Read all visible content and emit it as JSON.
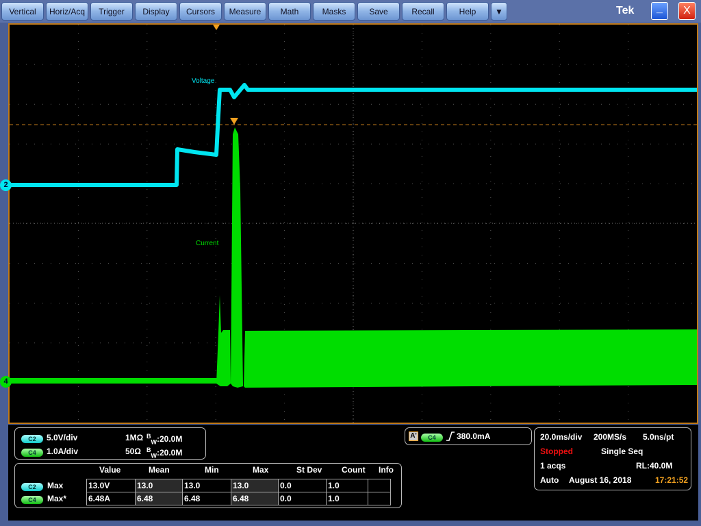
{
  "menu": {
    "items": [
      "Vertical",
      "Horiz/Acq",
      "Trigger",
      "Display",
      "Cursors",
      "Measure",
      "Math",
      "Masks",
      "Save",
      "Recall",
      "Help"
    ],
    "more": "▼",
    "brand": "Tek",
    "minimize": "_",
    "close": "X"
  },
  "scope": {
    "voltage_label": "Voltage",
    "current_label": "Current",
    "ch2_marker": "2",
    "ch4_marker": "4",
    "colors": {
      "ch2": "#00e5f0",
      "ch4": "#00dd00",
      "trigger": "#f0a020"
    }
  },
  "channels": [
    {
      "id": "C2",
      "scale": "5.0V/div",
      "impedance": "1MΩ",
      "bw": "20.0M"
    },
    {
      "id": "C4",
      "scale": "1.0A/div",
      "impedance": "50Ω",
      "bw": "20.0M"
    }
  ],
  "bw_prefix": "B",
  "bw_sub": "W",
  "measure": {
    "headers": [
      "Value",
      "Mean",
      "Min",
      "Max",
      "St Dev",
      "Count",
      "Info"
    ],
    "rows": [
      {
        "ch": "C2",
        "name": "Max",
        "cells": [
          "13.0V",
          "13.0",
          "13.0",
          "13.0",
          "0.0",
          "1.0",
          ""
        ]
      },
      {
        "ch": "C4",
        "name": "Max*",
        "cells": [
          "6.48A",
          "6.48",
          "6.48",
          "6.48",
          "0.0",
          "1.0",
          ""
        ]
      }
    ]
  },
  "trigger": {
    "source_tag": "A'",
    "channel": "C4",
    "slope": "rising",
    "level": "380.0mA"
  },
  "acq": {
    "timebase": "20.0ms/div",
    "sample_rate": "200MS/s",
    "resolution": "5.0ns/pt",
    "state": "Stopped",
    "mode": "Single Seq",
    "acqs": "1 acqs",
    "record_length": "RL:40.0M",
    "trigger_mode": "Auto",
    "date": "August 16, 2018",
    "time": "17:21:52"
  }
}
